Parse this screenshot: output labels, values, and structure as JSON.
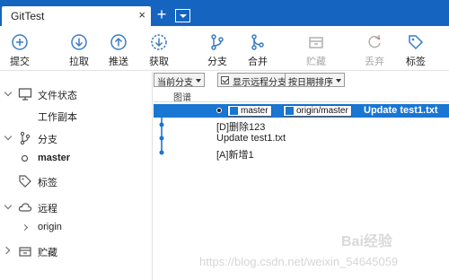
{
  "window": {
    "tab_title": "GitTest",
    "tab_close": "×",
    "tab_add": "+"
  },
  "toolbar": {
    "buttons": [
      {
        "label": "提交",
        "icon": "plus-circle-icon",
        "enabled": true
      },
      {
        "label": "拉取",
        "icon": "download-circle-icon",
        "enabled": true
      },
      {
        "label": "推送",
        "icon": "upload-circle-icon",
        "enabled": true
      },
      {
        "label": "获取",
        "icon": "fetch-circle-icon",
        "enabled": true
      },
      {
        "label": "分支",
        "icon": "branch-icon",
        "enabled": true
      },
      {
        "label": "合并",
        "icon": "merge-icon",
        "enabled": true
      },
      {
        "label": "贮藏",
        "icon": "stash-icon",
        "enabled": false
      },
      {
        "label": "丢弃",
        "icon": "discard-icon",
        "enabled": false
      },
      {
        "label": "标签",
        "icon": "tag-icon",
        "enabled": true
      }
    ]
  },
  "sidebar": {
    "sections": [
      {
        "label": "文件状态",
        "icon": "monitor-icon",
        "expanded": true,
        "items": [
          {
            "label": "工作副本"
          }
        ]
      },
      {
        "label": "分支",
        "icon": "branch-icon",
        "expanded": true,
        "items": [
          {
            "label": "master",
            "current": true
          }
        ]
      },
      {
        "label": "标签",
        "icon": "tag-icon",
        "expanded": false,
        "items": []
      },
      {
        "label": "远程",
        "icon": "cloud-icon",
        "expanded": true,
        "items": [
          {
            "label": "origin"
          }
        ]
      },
      {
        "label": "贮藏",
        "icon": "stash-icon",
        "expanded": false,
        "items": []
      }
    ]
  },
  "filters": {
    "branch_filter": "当前分支",
    "show_remote_label": "显示远程分支",
    "show_remote_checked": true,
    "sort_order": "按日期排序"
  },
  "history": {
    "graph_header": "图谱",
    "commits": [
      {
        "message": "Update test1.txt",
        "refs": [
          "master",
          "origin/master"
        ],
        "selected": true,
        "head": true
      },
      {
        "message": "[D]删除123",
        "refs": [],
        "selected": false
      },
      {
        "message": "Update test1.txt",
        "refs": [],
        "selected": false
      },
      {
        "message": "[A]新增1",
        "refs": [],
        "selected": false
      }
    ]
  },
  "colors": {
    "brand_blue": "#1565c0",
    "selection_blue": "#1976d2",
    "icon_blue": "#3a7cc4"
  },
  "watermark": {
    "text": "https://blog.csdn.net/weixin_54645059",
    "logo": "Bai经验"
  }
}
